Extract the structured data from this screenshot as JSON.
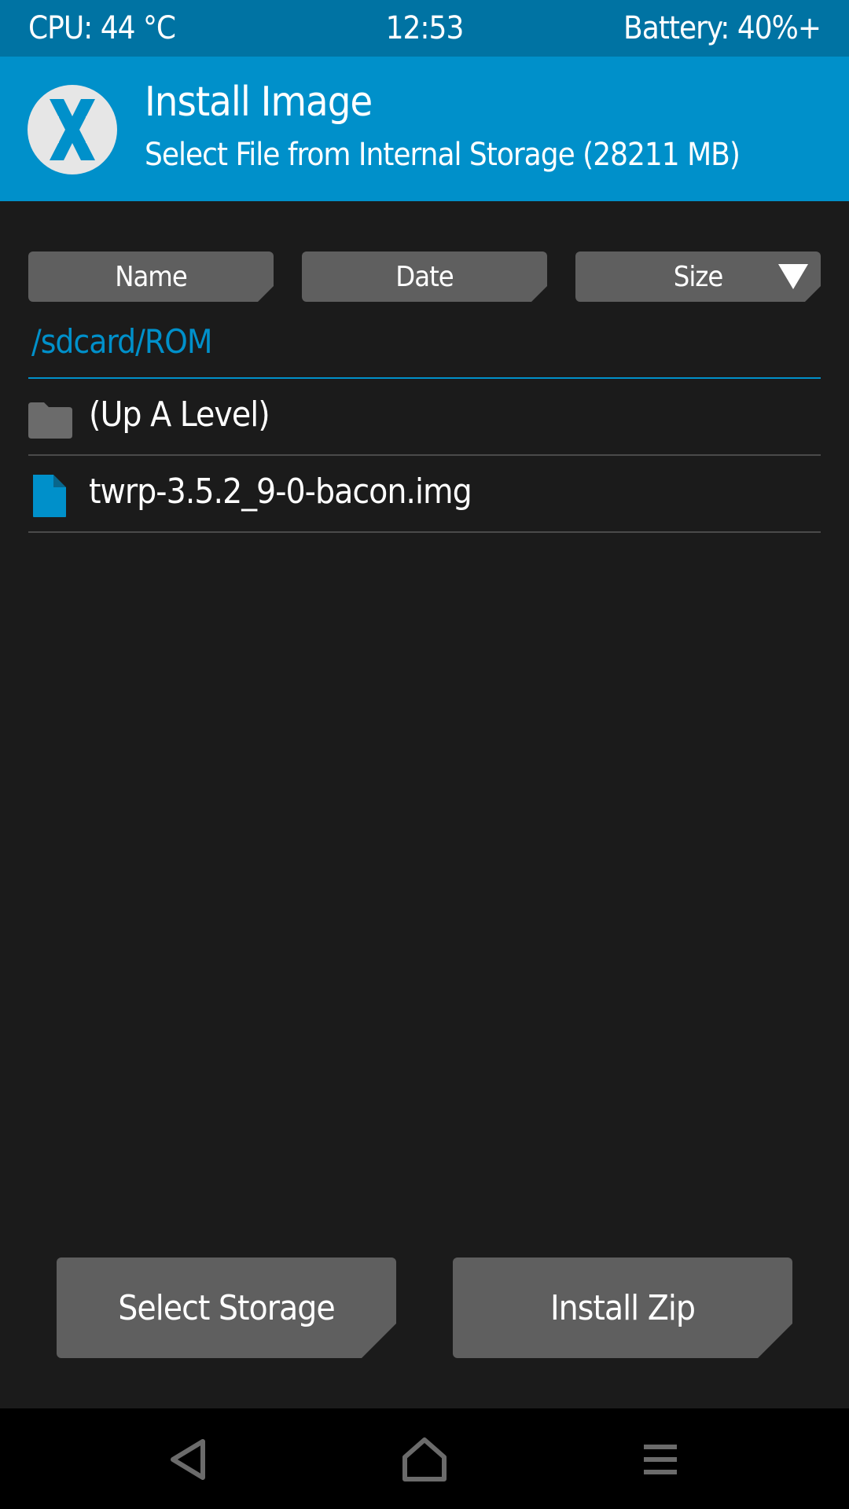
{
  "status_bar": {
    "cpu": "CPU: 44 °C",
    "time": "12:53",
    "battery": "Battery: 40%+"
  },
  "header": {
    "title": "Install Image",
    "subtitle": "Select File from Internal Storage (28211 MB)",
    "logo_icon": "twrp-logo-icon"
  },
  "sort_buttons": {
    "name": "Name",
    "date": "Date",
    "size": "Size",
    "active_sort_indicator": "chevron-down-icon"
  },
  "path": "/sdcard/ROM",
  "files": [
    {
      "label": "(Up A Level)",
      "icon": "folder-icon"
    },
    {
      "label": "twrp-3.5.2_9-0-bacon.img",
      "icon": "file-icon"
    }
  ],
  "actions": {
    "select_storage": "Select Storage",
    "install_zip": "Install Zip"
  },
  "nav": {
    "back_icon": "back-icon",
    "home_icon": "home-icon",
    "menu_icon": "menu-icon"
  },
  "colors": {
    "accent": "#0090ca",
    "status_bar": "#0073a3",
    "background": "#1b1b1b",
    "button": "#5f5f5f"
  }
}
